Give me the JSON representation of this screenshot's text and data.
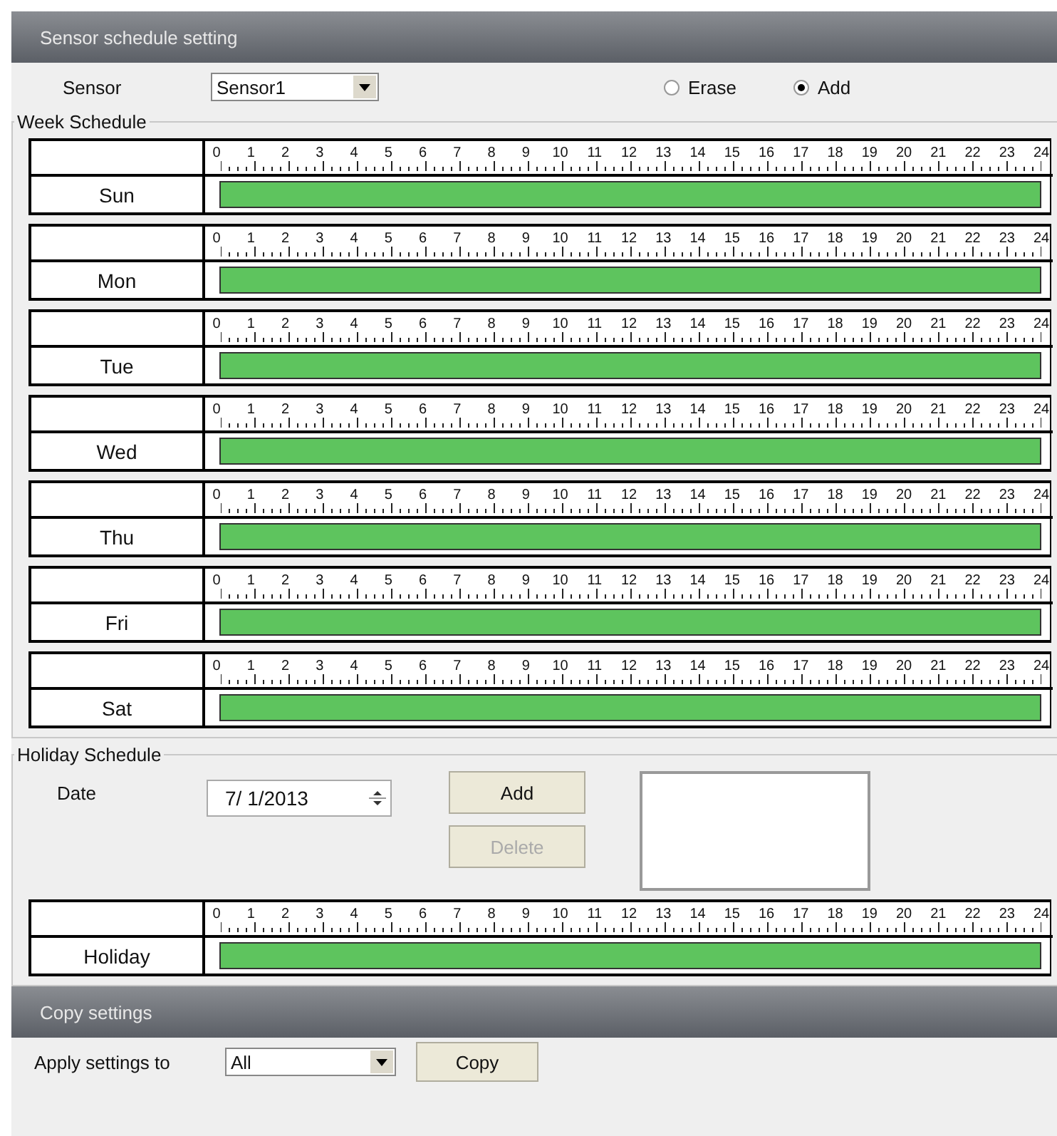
{
  "header": {
    "title": "Sensor schedule setting"
  },
  "sensor": {
    "label": "Sensor",
    "value": "Sensor1"
  },
  "modes": [
    {
      "label": "Erase",
      "selected": false
    },
    {
      "label": "Add",
      "selected": true
    }
  ],
  "week_schedule": {
    "title": "Week Schedule",
    "rows": [
      {
        "day": "Sun",
        "hours": [
          "0",
          "1",
          "2",
          "3",
          "4",
          "5",
          "6",
          "7",
          "8",
          "9",
          "10",
          "11",
          "12",
          "13",
          "14",
          "15",
          "16",
          "17",
          "18",
          "19",
          "20",
          "21",
          "22",
          "23",
          "24"
        ],
        "armed": true
      },
      {
        "day": "Mon",
        "hours": [
          "0",
          "1",
          "2",
          "3",
          "4",
          "5",
          "6",
          "7",
          "8",
          "9",
          "10",
          "11",
          "12",
          "13",
          "14",
          "15",
          "16",
          "17",
          "18",
          "19",
          "20",
          "21",
          "22",
          "23",
          "24"
        ],
        "armed": true
      },
      {
        "day": "Tue",
        "hours": [
          "0",
          "1",
          "2",
          "3",
          "4",
          "5",
          "6",
          "7",
          "8",
          "9",
          "10",
          "11",
          "12",
          "13",
          "14",
          "15",
          "16",
          "17",
          "18",
          "19",
          "20",
          "21",
          "22",
          "23",
          "24"
        ],
        "armed": true
      },
      {
        "day": "Wed",
        "hours": [
          "0",
          "1",
          "2",
          "3",
          "4",
          "5",
          "6",
          "7",
          "8",
          "9",
          "10",
          "11",
          "12",
          "13",
          "14",
          "15",
          "16",
          "17",
          "18",
          "19",
          "20",
          "21",
          "22",
          "23",
          "24"
        ],
        "armed": true
      },
      {
        "day": "Thu",
        "hours": [
          "0",
          "1",
          "2",
          "3",
          "4",
          "5",
          "6",
          "7",
          "8",
          "9",
          "10",
          "11",
          "12",
          "13",
          "14",
          "15",
          "16",
          "17",
          "18",
          "19",
          "20",
          "21",
          "22",
          "23",
          "24"
        ],
        "armed": true
      },
      {
        "day": "Fri",
        "hours": [
          "0",
          "1",
          "2",
          "3",
          "4",
          "5",
          "6",
          "7",
          "8",
          "9",
          "10",
          "11",
          "12",
          "13",
          "14",
          "15",
          "16",
          "17",
          "18",
          "19",
          "20",
          "21",
          "22",
          "23",
          "24"
        ],
        "armed": true
      },
      {
        "day": "Sat",
        "hours": [
          "0",
          "1",
          "2",
          "3",
          "4",
          "5",
          "6",
          "7",
          "8",
          "9",
          "10",
          "11",
          "12",
          "13",
          "14",
          "15",
          "16",
          "17",
          "18",
          "19",
          "20",
          "21",
          "22",
          "23",
          "24"
        ],
        "armed": true
      }
    ]
  },
  "holiday_schedule": {
    "title": "Holiday Schedule",
    "date_label": "Date",
    "date_value": "7/ 1/2013",
    "buttons": [
      {
        "label": "Add",
        "disabled": false
      },
      {
        "label": "Delete",
        "disabled": true
      }
    ],
    "row": {
      "day": "Holiday",
      "hours": [
        "0",
        "1",
        "2",
        "3",
        "4",
        "5",
        "6",
        "7",
        "8",
        "9",
        "10",
        "11",
        "12",
        "13",
        "14",
        "15",
        "16",
        "17",
        "18",
        "19",
        "20",
        "21",
        "22",
        "23",
        "24"
      ],
      "armed": true
    }
  },
  "copy": {
    "title": "Copy settings",
    "label": "Apply settings to",
    "value": "All",
    "button": "Copy"
  }
}
